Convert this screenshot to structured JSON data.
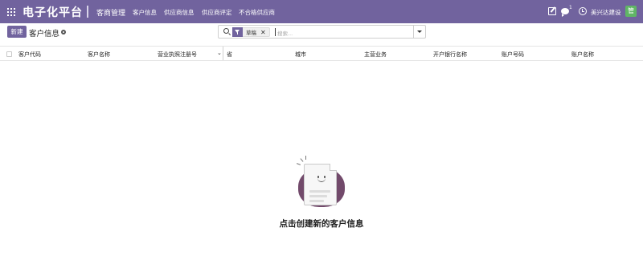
{
  "navbar": {
    "brand": "电子化平台",
    "app_title": "客商管理",
    "menu": [
      "客户信息",
      "供应商信息",
      "供应商评定",
      "不合格供应商"
    ],
    "chat_count": "1",
    "company": "美兴达建设",
    "avatar_initial": "管",
    "bg_color": "#71639e"
  },
  "control": {
    "new_label": "新建",
    "breadcrumb": "客户信息"
  },
  "search": {
    "facet_label": "草稿",
    "placeholder": "搜索..."
  },
  "table": {
    "columns": [
      "客户代码",
      "客户名称",
      "营业执照注册号",
      "省",
      "城市",
      "主营业务",
      "开户银行名称",
      "账户号码",
      "账户名称"
    ]
  },
  "empty_state": {
    "title": "点击创建新的客户信息"
  }
}
